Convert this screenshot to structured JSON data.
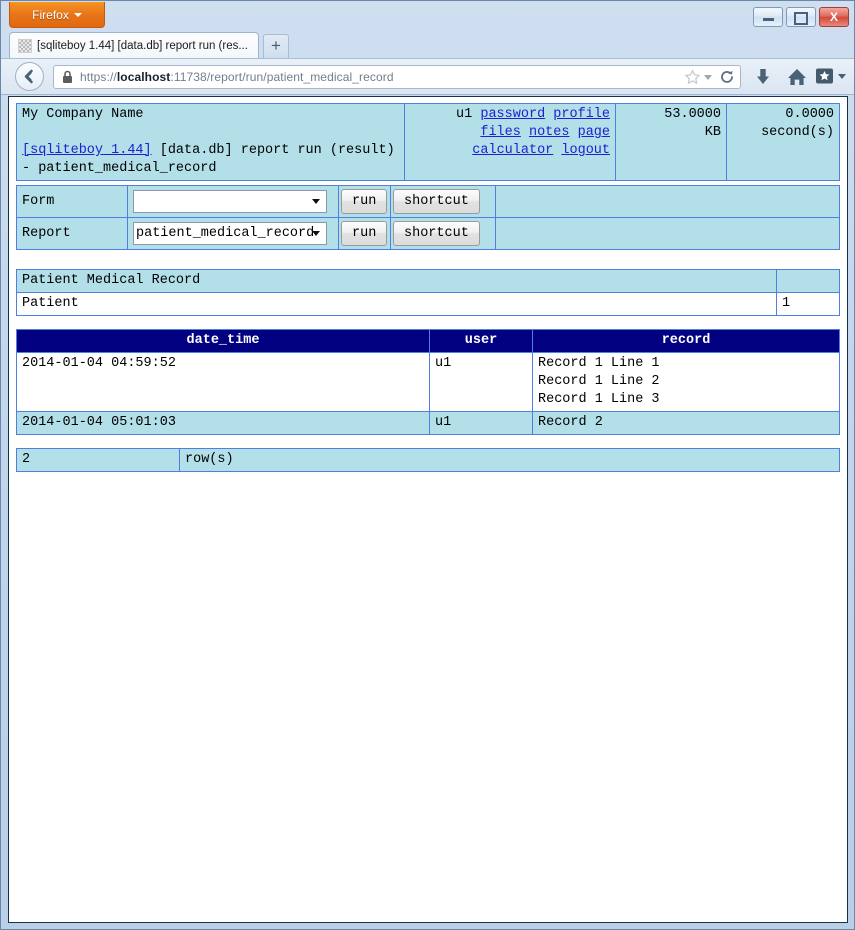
{
  "browser": {
    "menu_button_label": "Firefox",
    "tab_title": "[sqliteboy 1.44] [data.db] report run (res...",
    "new_tab_label": "+",
    "url_scheme": "https://",
    "url_host": "localhost",
    "url_rest": ":11738/report/run/patient_medical_record",
    "window_controls": {
      "minimize": "minimize",
      "maximize": "maximize",
      "close": "X"
    },
    "icons": {
      "back": "back-arrow-icon",
      "lock": "lock-icon",
      "star": "star-icon",
      "reload": "reload-icon",
      "download": "download-icon",
      "home": "home-icon",
      "bookmarks": "bookmarks-icon"
    }
  },
  "header": {
    "company": "My Company Name",
    "app_link": "[sqliteboy 1.44]",
    "breadcrumb": " [data.db] report run (result) - patient_medical_record",
    "user": "u1",
    "links": [
      "password",
      "profile",
      "files",
      "notes",
      "page",
      "calculator",
      "logout"
    ],
    "size_value": "53.0000",
    "size_unit": "KB",
    "time_value": "0.0000",
    "time_unit": "second(s)"
  },
  "controls": {
    "rows": [
      {
        "label": "Form",
        "select_value": "",
        "run_label": "run",
        "shortcut_label": "shortcut"
      },
      {
        "label": "Report",
        "select_value": "patient_medical_record",
        "run_label": "run",
        "shortcut_label": "shortcut"
      }
    ]
  },
  "params": {
    "title": "Patient Medical Record",
    "title_extra": "",
    "rows": [
      {
        "name": "Patient",
        "value": "1"
      }
    ]
  },
  "result": {
    "columns": [
      "date_time",
      "user",
      "record"
    ],
    "rows": [
      {
        "date_time": "2014-01-04 04:59:52",
        "user": "u1",
        "record": "Record 1 Line 1\nRecord 1 Line 2\nRecord 1 Line 3"
      },
      {
        "date_time": "2014-01-04 05:01:03",
        "user": "u1",
        "record": "Record 2"
      }
    ]
  },
  "count": {
    "value": "2",
    "label": "row(s)"
  }
}
